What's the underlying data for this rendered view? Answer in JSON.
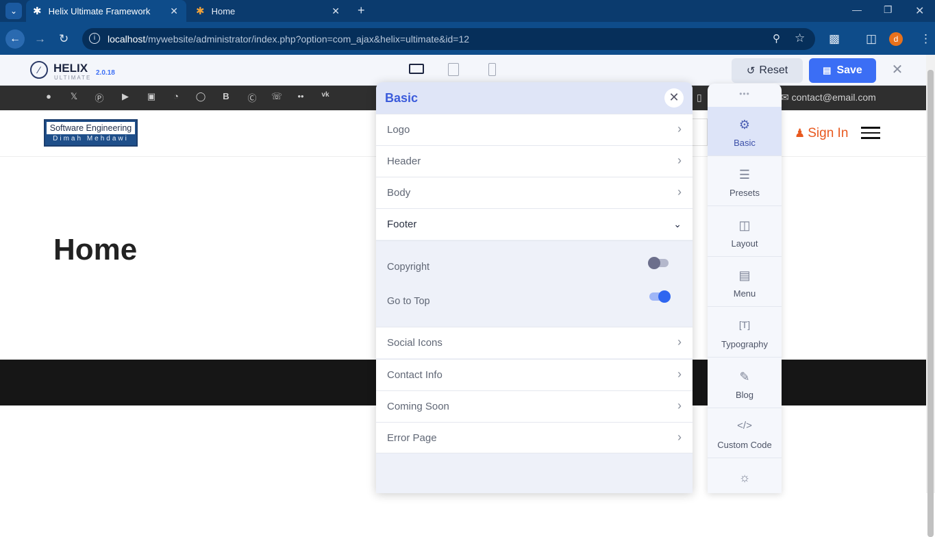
{
  "browser": {
    "tabs": [
      {
        "title": "Helix Ultimate Framework",
        "active": true
      },
      {
        "title": "Home",
        "active": false
      }
    ],
    "url_host": "localhost",
    "url_path": "/mywebsite/administrator/index.php?option=com_ajax&helix=ultimate&id=12",
    "profile_initial": "d"
  },
  "helix": {
    "brand": "HELIX",
    "brand_sub": "ULTIMATE",
    "version": "2.0.18",
    "reset_label": "Reset",
    "save_label": "Save"
  },
  "site": {
    "contact_email": "contact@email.com",
    "logo_line1": "Software Engineering",
    "logo_line2": "Dimah Mehdawi",
    "sign_in": "Sign In",
    "page_title": "Home"
  },
  "panel": {
    "title": "Basic",
    "rows": [
      {
        "label": "Logo"
      },
      {
        "label": "Header"
      },
      {
        "label": "Body"
      },
      {
        "label": "Footer",
        "expanded": true
      }
    ],
    "footer_options": [
      {
        "label": "Copyright",
        "enabled": false
      },
      {
        "label": "Go to Top",
        "enabled": true
      }
    ],
    "rows_after": [
      {
        "label": "Social Icons"
      },
      {
        "label": "Contact Info"
      },
      {
        "label": "Coming Soon"
      },
      {
        "label": "Error Page"
      }
    ]
  },
  "rail": {
    "items": [
      {
        "label": "Basic",
        "icon": "gear-icon",
        "active": true
      },
      {
        "label": "Presets",
        "icon": "sliders-icon"
      },
      {
        "label": "Layout",
        "icon": "layout-icon"
      },
      {
        "label": "Menu",
        "icon": "menu-list-icon"
      },
      {
        "label": "Typography",
        "icon": "typography-icon"
      },
      {
        "label": "Blog",
        "icon": "blog-icon"
      },
      {
        "label": "Custom Code",
        "icon": "code-icon"
      }
    ]
  }
}
